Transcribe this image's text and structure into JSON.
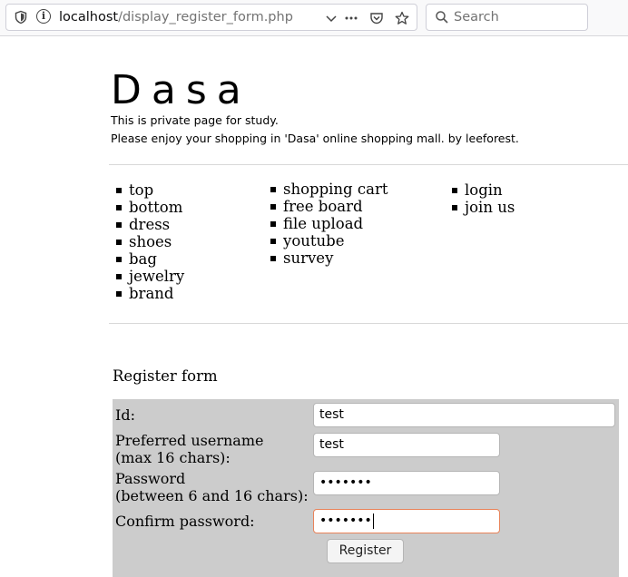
{
  "browser": {
    "url_host": "localhost",
    "url_path": "/display_register_form.php",
    "search_placeholder": "Search",
    "icons": [
      "shield-icon",
      "info-icon",
      "chevron-down-icon",
      "more-icon",
      "pocket-icon",
      "bookmark-star-icon",
      "search-icon"
    ]
  },
  "site": {
    "logo": "Dasa",
    "intro_line1": "This is private page for study.",
    "intro_line2": "Please enjoy your shopping in 'Dasa' online shopping mall. by leeforest."
  },
  "menu": {
    "col1": [
      "top",
      "bottom",
      "dress",
      "shoes",
      "bag",
      "jewelry",
      "brand"
    ],
    "col2": [
      "shopping cart",
      "free board",
      "file upload",
      "youtube",
      "survey"
    ],
    "col3": [
      "login",
      "join us"
    ]
  },
  "form": {
    "title": "Register form",
    "id_label": "Id:",
    "id_value": "test",
    "username_label_1": "Preferred username",
    "username_label_2": "(max 16 chars):",
    "username_value": "test",
    "password_label_1": "Password",
    "password_label_2": "(between 6 and 16 chars):",
    "password_value": "•••••••",
    "confirm_label": "Confirm password:",
    "confirm_value": "•••••••",
    "submit_label": "Register"
  },
  "colors": {
    "form_background": "#cccccc",
    "focus_border": "#e8835a"
  }
}
